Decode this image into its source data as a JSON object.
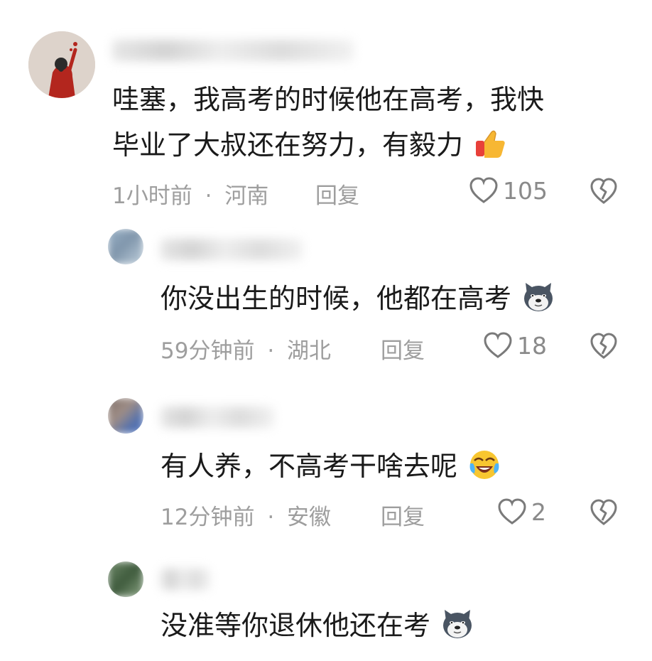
{
  "comments": [
    {
      "text_line1": "哇塞，我高考的时候他在高考，我快",
      "text_line2": "毕业了大叔还在努力，有毅力",
      "emoji": "thumbs-up-icon",
      "time": "1小时前",
      "sep": "·",
      "location": "河南",
      "reply_label": "回复",
      "likes": "105"
    },
    {
      "text": "你没出生的时候，他都在高考",
      "emoji": "doge-icon",
      "time": "59分钟前",
      "sep": "·",
      "location": "湖北",
      "reply_label": "回复",
      "likes": "18"
    },
    {
      "text": "有人养，不高考干啥去呢",
      "emoji": "laugh-cry-icon",
      "time": "12分钟前",
      "sep": "·",
      "location": "安徽",
      "reply_label": "回复",
      "likes": "2"
    },
    {
      "text": "没准等你退休他还在考",
      "emoji": "doge-icon"
    }
  ],
  "colors": {
    "text": "#1a1a1a",
    "meta": "#9e9e9e",
    "avatar_red": "#b3261e",
    "avatar_bg": "#d9cfc7"
  }
}
